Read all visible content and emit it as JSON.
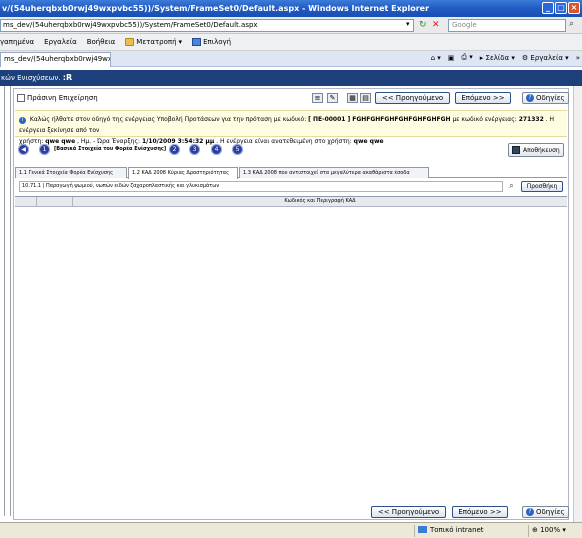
{
  "window": {
    "title": "v/(54uherqbxb0rwj49wxpvbc55))/System/FrameSet0/Default.aspx - Windows Internet Explorer"
  },
  "addressbar": {
    "url": "ms_dev/(54uherqbxb0rwj49wxpvbc55))/System/FrameSet0/Default.aspx",
    "search_placeholder": "Google"
  },
  "menubar": {
    "items": [
      "γαπημένα",
      "Εργαλεία",
      "Βοήθεια"
    ],
    "translate_label": "Μετατροπή",
    "select_label": "Επιλογή"
  },
  "browser_tab": {
    "label": "ms_dev/(54uherqbxb0rwj49wxxv..."
  },
  "command_bar": {
    "page_label": "Σελίδα",
    "tools_label": "Εργαλεία"
  },
  "app_header": {
    "text": "κών Ενισχύσεων. ",
    "suffix": ":R"
  },
  "action_row": {
    "title": "Πράσινη Επιχείρηση",
    "prev_label": "<< Προηγούμενο",
    "next_label": "Επόμενο >>",
    "help_label": "Οδηγίες"
  },
  "info": {
    "line1_a": "Καλώς ήλθατε στον οδηγό της ενέργειας Υποβολή Προτάσεων για την πρόταση με κωδικό:",
    "proposal_code": "[ ΠΕ-00001 ]",
    "proposal_name": "FGHFGHFGHFGHFGHFGHFGH",
    "line1_b": "με κωδικό ενέργειας:",
    "action_code": "271332",
    "line1_c": ". Η ενέργεια ξεκίνησε από τον",
    "line2_a": "χρήστη:",
    "user_start": "qwe qwe",
    "line2_b": ", Ημ. - Ώρα Έναρξης:",
    "start_time": "1/10/2009 3:54:32 μμ",
    "line2_c": ". Η ενέργεια είναι ανατεθειμένη στο χρήστη:",
    "user_assigned": "qwe qwe"
  },
  "steps": {
    "nums": [
      "1",
      "2",
      "3",
      "4",
      "5"
    ],
    "current_label": "[Βασικά Στοιχεία του Φορέα Ενίσχυσης]",
    "save_label": "Αποθήκευση"
  },
  "form_tabs": [
    "1.1 Γενικά Στοιχεία Φορέα Ενίσχυσης",
    "1.2 ΚΑΔ 2008 Κύριας Δραστηριότητας",
    "1.3 ΚΑΔ 2008 που αντιστοιχεί στα μεγαλύτερα ακαθάριστα έσοδα"
  ],
  "kad": {
    "value": "10.71.1 | Παραγωγή ψωμιού, νωπών ειδών ζαχαροπλαστικής και γλυκισμάτων",
    "add_label": "Προσθήκη"
  },
  "grid": {
    "column_header": "Κωδικός και Περιγραφή ΚΑΔ"
  },
  "status": {
    "zone": "Τοπικό intranet",
    "zoom": "100%"
  }
}
